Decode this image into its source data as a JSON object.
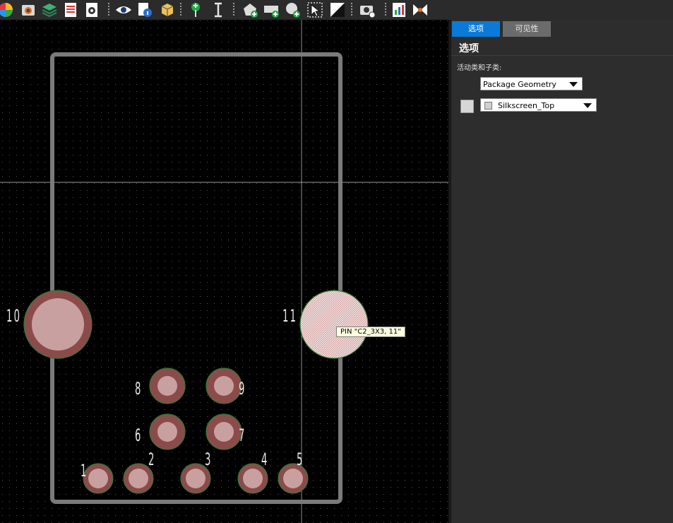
{
  "toolbar": {
    "icons": [
      "color-wheel-icon",
      "camera-layers-icon",
      "layers-icon",
      "spreadsheet-icon",
      "gear-document-icon",
      "eye-icon",
      "info-document-icon",
      "3d-box-icon",
      "add-pin-icon",
      "text-cursor-icon",
      "add-shape-icon",
      "add-rectangle-icon",
      "add-circle-icon",
      "select-cursor-icon",
      "half-fill-icon",
      "camera-settings-icon",
      "report-chart-icon",
      "bowtie-icon"
    ]
  },
  "panel": {
    "tabs": [
      "选项",
      "可见性"
    ],
    "title": "选项",
    "class_label": "活动类和子类:",
    "class_value": "Package Geometry",
    "subclass_value": "Silkscreen_Top"
  },
  "canvas": {
    "pin_labels": [
      "1",
      "2",
      "3",
      "4",
      "5",
      "6",
      "7",
      "8",
      "9",
      "10",
      "11"
    ],
    "tooltip": "PIN \"C2_3X3, 11\"",
    "colors": {
      "outline": "#7a7a7a",
      "pad": "#8c4b4b",
      "pad_center": "#c9a0a0",
      "pad_edge": "#2e7a2e",
      "grid": "#5a5a5a"
    }
  }
}
